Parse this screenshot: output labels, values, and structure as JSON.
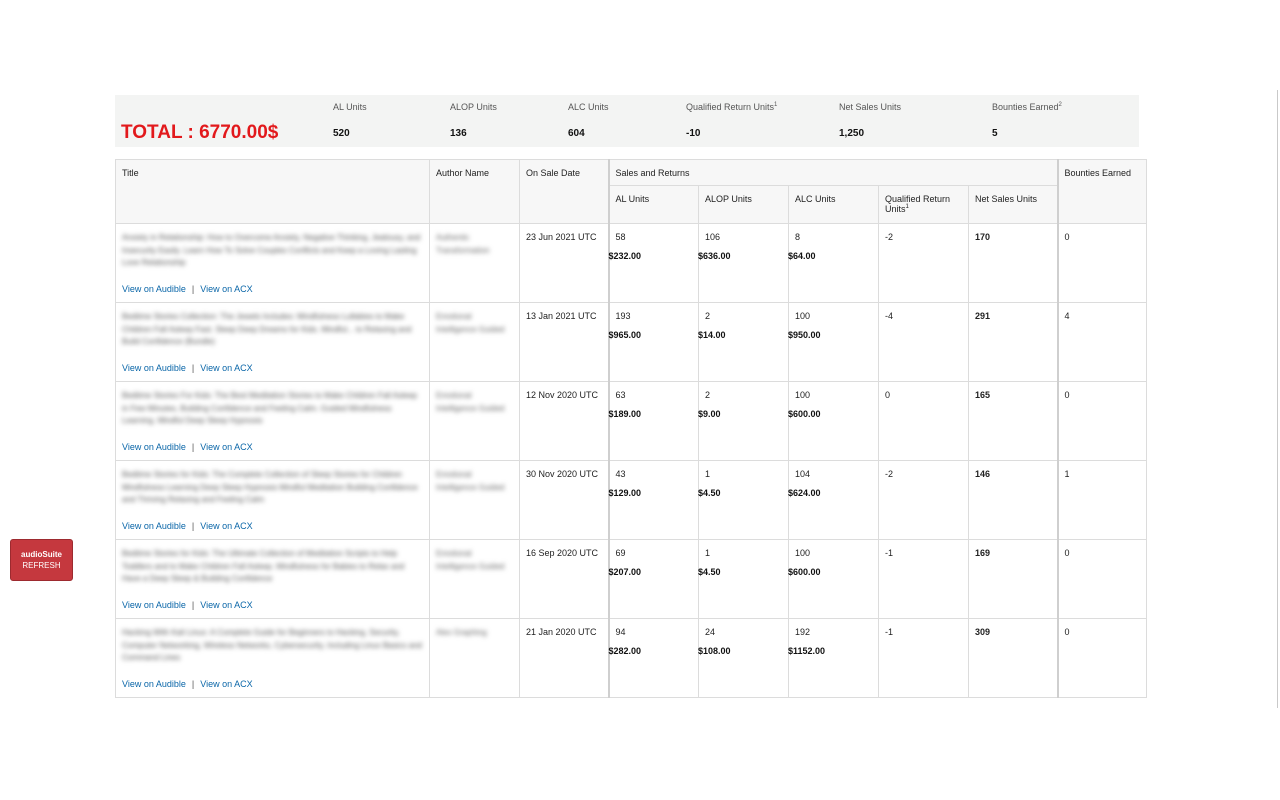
{
  "summary": {
    "total": "TOTAL : 6770.00$",
    "columns": [
      {
        "label": "AL Units",
        "value": "520"
      },
      {
        "label": "ALOP Units",
        "value": "136"
      },
      {
        "label": "ALC Units",
        "value": "604"
      },
      {
        "label": "Qualified Return Units",
        "sup": "1",
        "value": "-10"
      },
      {
        "label": "Net Sales Units",
        "value": "1,250"
      },
      {
        "label": "Bounties Earned",
        "sup": "2",
        "value": "5"
      }
    ]
  },
  "table": {
    "headers": {
      "title": "Title",
      "author": "Author Name",
      "on_sale": "On Sale Date",
      "sales_returns": "Sales and Returns",
      "al": "AL Units",
      "alop": "ALOP Units",
      "alc": "ALC Units",
      "qru": "Qualified Return Units",
      "qru_sup": "1",
      "net": "Net Sales Units",
      "bounties": "Bounties Earned"
    },
    "link_audible": "View on Audible",
    "link_sep": "|",
    "link_acx": "View on ACX",
    "rows": [
      {
        "title": "Anxiety in Relationship: How to Overcome Anxiety, Negative Thinking, Jealousy, and Insecurity Easily. Learn How To Solve Couples Conflicts and Keep a Loving Lasting Love Relationship",
        "author": "Authentic Transformation",
        "date": "23 Jun 2021 UTC",
        "al": "58",
        "al_amt": "$232.00",
        "alop": "106",
        "alop_amt": "$636.00",
        "alc": "8",
        "alc_amt": "$64.00",
        "qru": "-2",
        "net": "170",
        "bounties": "0"
      },
      {
        "title": "Bedtime Stories Collection: The Jewels Includes: Mindfulness Lullabies to Make Children Fall Asleep Fast. Sleep Deep Dreams for Kids. Mindful... to Relaxing and Build Confidence (Bundle)",
        "author": "Emotional Intelligence Guided",
        "date": "13 Jan 2021 UTC",
        "al": "193",
        "al_amt": "$965.00",
        "alop": "2",
        "alop_amt": "$14.00",
        "alc": "100",
        "alc_amt": "$950.00",
        "qru": "-4",
        "net": "291",
        "bounties": "4"
      },
      {
        "title": "Bedtime Stories For Kids: The Best Meditation Stories to Make Children Fall Asleep in Few Minutes, Building Confidence and Feeling Calm. Guided Mindfulness Learning. Mindful Deep Sleep Hypnosis",
        "author": "Emotional Intelligence Guided",
        "date": "12 Nov 2020 UTC",
        "al": "63",
        "al_amt": "$189.00",
        "alop": "2",
        "alop_amt": "$9.00",
        "alc": "100",
        "alc_amt": "$600.00",
        "qru": "0",
        "net": "165",
        "bounties": "0"
      },
      {
        "title": "Bedtime Stories for Kids: The Complete Collection of Sleep Stories for Children Mindfulness Learning Deep Sleep Hypnosis Mindful Meditation Building Confidence and Thriving Relaxing and Feeling Calm",
        "author": "Emotional Intelligence Guided",
        "date": "30 Nov 2020 UTC",
        "al": "43",
        "al_amt": "$129.00",
        "alop": "1",
        "alop_amt": "$4.50",
        "alc": "104",
        "alc_amt": "$624.00",
        "qru": "-2",
        "net": "146",
        "bounties": "1"
      },
      {
        "title": "Bedtime Stories for Kids: The Ultimate Collection of Meditation Scripts to Help Toddlers and to Make Children Fall Asleep. Mindfulness for Babies to Relax and Have a Deep Sleep & Building Confidence",
        "author": "Emotional Intelligence Guided",
        "date": "16 Sep 2020 UTC",
        "al": "69",
        "al_amt": "$207.00",
        "alop": "1",
        "alop_amt": "$4.50",
        "alc": "100",
        "alc_amt": "$600.00",
        "qru": "-1",
        "net": "169",
        "bounties": "0"
      },
      {
        "title": "Hacking With Kali Linux: A Complete Guide for Beginners to Hacking, Security, Computer Networking, Wireless Networks, Cybersecurity, Including Linux Basics and Command Lines",
        "author": "Alex Graphing",
        "date": "21 Jan 2020 UTC",
        "al": "94",
        "al_amt": "$282.00",
        "alop": "24",
        "alop_amt": "$108.00",
        "alc": "192",
        "alc_amt": "$1152.00",
        "qru": "-1",
        "net": "309",
        "bounties": "0"
      }
    ]
  },
  "refresh_button": {
    "line1": "audioSuite",
    "line2": "REFRESH"
  },
  "colors": {
    "total": "#e2191c",
    "link": "#0a66a8",
    "refresh_bg": "#c5383e"
  }
}
